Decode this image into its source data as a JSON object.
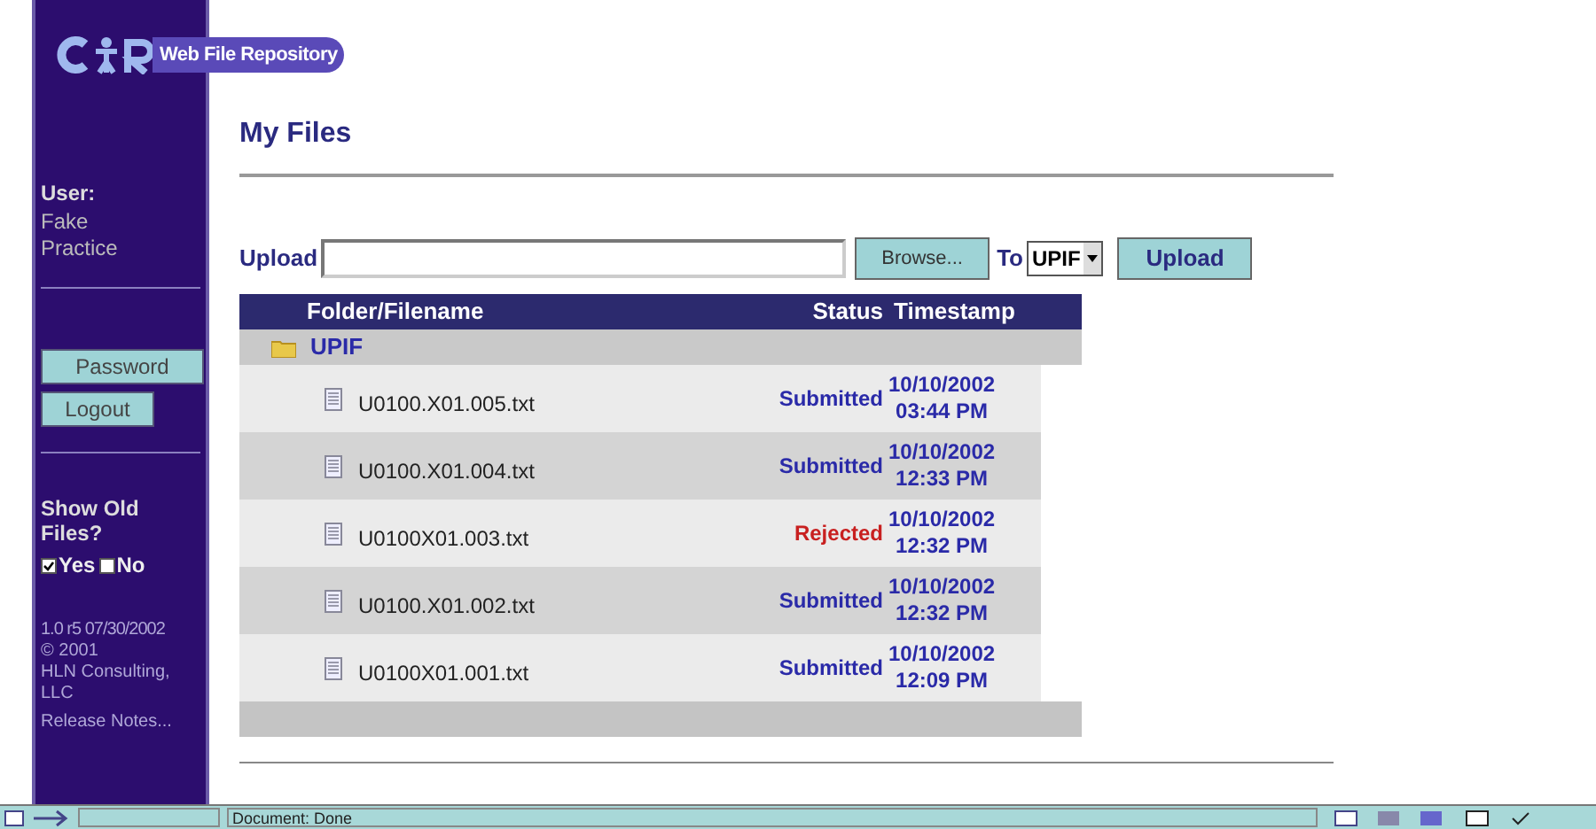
{
  "sidebar": {
    "logo_text": "Web File Repository",
    "user_label": "User:",
    "user_name": "Fake Practice",
    "buttons": [
      "Password",
      "Logout"
    ],
    "show_old_files": {
      "label": "Show Old Files?",
      "options": [
        {
          "label": "Yes",
          "checked": true
        },
        {
          "label": "No",
          "checked": false
        }
      ]
    },
    "version": "1.0 r5 07/30/2002",
    "copyright": "© 2001",
    "company": "HLN Consulting, LLC",
    "release_notes": "Release Notes..."
  },
  "page_title": "My Files",
  "upload": {
    "label": "Upload",
    "browse_button": "Browse...",
    "to_label": "To",
    "destination": "UPIF",
    "submit_button": "Upload"
  },
  "table": {
    "columns": [
      "Folder/Filename",
      "Status",
      "Timestamp"
    ],
    "folder": "UPIF",
    "rows": [
      {
        "filename": "U0100.X01.005.txt",
        "status": "Submitted",
        "kind": "submitted",
        "date": "10/10/2002",
        "time": "03:44 PM"
      },
      {
        "filename": "U0100.X01.004.txt",
        "status": "Submitted",
        "kind": "submitted",
        "date": "10/10/2002",
        "time": "12:33 PM"
      },
      {
        "filename": "U0100X01.003.txt",
        "status": "Rejected",
        "kind": "rejected",
        "date": "10/10/2002",
        "time": "12:32 PM"
      },
      {
        "filename": "U0100.X01.002.txt",
        "status": "Submitted",
        "kind": "submitted",
        "date": "10/10/2002",
        "time": "12:32 PM"
      },
      {
        "filename": "U0100X01.001.txt",
        "status": "Submitted",
        "kind": "submitted",
        "date": "10/10/2002",
        "time": "12:09 PM"
      }
    ]
  },
  "status_bar": {
    "text": "Document: Done"
  }
}
